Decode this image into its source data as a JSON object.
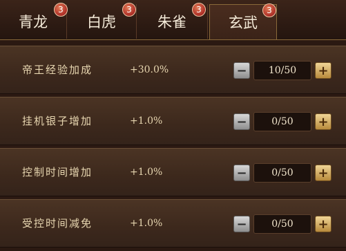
{
  "tabs": [
    {
      "label": "青龙",
      "badge": "3"
    },
    {
      "label": "白虎",
      "badge": "3"
    },
    {
      "label": "朱雀",
      "badge": "3"
    },
    {
      "label": "玄武",
      "badge": "3",
      "active": true
    }
  ],
  "rows": [
    {
      "name": "帝王经验加成",
      "value": "+30.0%",
      "counter": "10/50",
      "minus": "−",
      "plus": "+"
    },
    {
      "name": "挂机银子增加",
      "value": "+1.0%",
      "counter": "0/50",
      "minus": "−",
      "plus": "+"
    },
    {
      "name": "控制时间增加",
      "value": "+1.0%",
      "counter": "0/50",
      "minus": "−",
      "plus": "+"
    },
    {
      "name": "受控时间减免",
      "value": "+1.0%",
      "counter": "0/50",
      "minus": "−",
      "plus": "+"
    }
  ],
  "colors": {
    "badge": "#b0322a",
    "text": "#e7d6b0",
    "plus_button": "#d9b46a",
    "minus_button": "#bdbdbd"
  }
}
